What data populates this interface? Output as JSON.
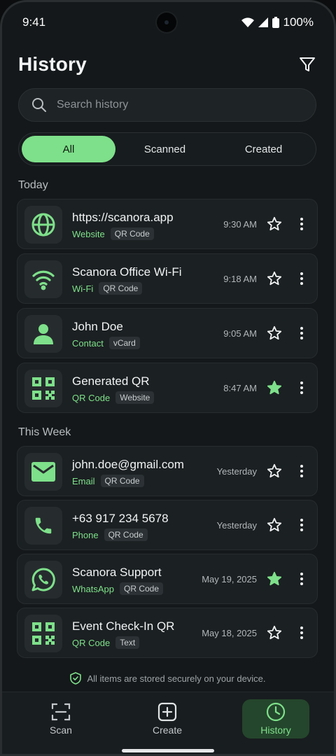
{
  "status_bar": {
    "time": "9:41",
    "battery": "100%"
  },
  "header": {
    "title": "History"
  },
  "search": {
    "placeholder": "Search history"
  },
  "tabs": [
    {
      "label": "All",
      "active": true
    },
    {
      "label": "Scanned",
      "active": false
    },
    {
      "label": "Created",
      "active": false
    }
  ],
  "sections": [
    {
      "label": "Today",
      "items": [
        {
          "title": "https://scanora.app",
          "type": "Website",
          "badge": "QR Code",
          "time": "9:30 AM",
          "starred": false,
          "icon": "globe-icon"
        },
        {
          "title": "Scanora Office Wi-Fi",
          "type": "Wi-Fi",
          "badge": "QR Code",
          "time": "9:18 AM",
          "starred": false,
          "icon": "wifi-icon"
        },
        {
          "title": "John Doe",
          "type": "Contact",
          "badge": "vCard",
          "time": "9:05 AM",
          "starred": false,
          "icon": "person-icon"
        },
        {
          "title": "Generated QR",
          "type": "QR Code",
          "badge": "Website",
          "time": "8:47 AM",
          "starred": true,
          "icon": "qr-code-icon"
        }
      ]
    },
    {
      "label": "This Week",
      "items": [
        {
          "title": "john.doe@gmail.com",
          "type": "Email",
          "badge": "QR Code",
          "time": "Yesterday",
          "starred": false,
          "icon": "mail-icon"
        },
        {
          "title": "+63 917 234 5678",
          "type": "Phone",
          "badge": "QR Code",
          "time": "Yesterday",
          "starred": false,
          "icon": "phone-icon"
        },
        {
          "title": "Scanora Support",
          "type": "WhatsApp",
          "badge": "QR Code",
          "time": "May 19, 2025",
          "starred": true,
          "icon": "whatsapp-icon"
        },
        {
          "title": "Event Check-In QR",
          "type": "QR Code",
          "badge": "Text",
          "time": "May 18, 2025",
          "starred": false,
          "icon": "qr-code-icon"
        }
      ]
    }
  ],
  "footer_note": "All items are stored securely on your device.",
  "nav": [
    {
      "label": "Scan",
      "icon": "scan-icon",
      "active": false
    },
    {
      "label": "Create",
      "icon": "plus-square-icon",
      "active": false
    },
    {
      "label": "History",
      "icon": "clock-icon",
      "active": true
    }
  ],
  "colors": {
    "accent": "#7ee08a",
    "background": "#14181a",
    "card": "#1b2022"
  }
}
